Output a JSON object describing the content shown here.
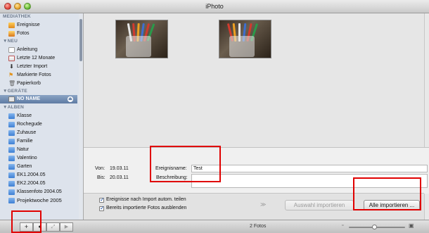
{
  "window": {
    "title": "iPhoto"
  },
  "sidebar": {
    "sections": [
      {
        "label": "MEDIATHEK"
      },
      {
        "label": "▼NEU"
      },
      {
        "label": "▼GERÄTE"
      },
      {
        "label": "▼ALBEN"
      }
    ],
    "mediathek": [
      {
        "label": "Ereignisse",
        "icon": "events-icon"
      },
      {
        "label": "Fotos",
        "icon": "photos-icon"
      }
    ],
    "neu": [
      {
        "label": "Anleitung",
        "icon": "document-icon"
      },
      {
        "label": "Letzte 12 Monate",
        "icon": "calendar-icon"
      },
      {
        "label": "Letzter Import",
        "icon": "import-icon"
      },
      {
        "label": "Markierte Fotos",
        "icon": "flag-icon"
      },
      {
        "label": "Papierkorb",
        "icon": "trash-icon"
      }
    ],
    "geraete": [
      {
        "label": "NO NAME",
        "icon": "device-icon",
        "selected": true
      }
    ],
    "alben": [
      {
        "label": "Klasse"
      },
      {
        "label": "Rochegude"
      },
      {
        "label": "Zuhause"
      },
      {
        "label": "Familie"
      },
      {
        "label": "Natur"
      },
      {
        "label": "Valentino"
      },
      {
        "label": "Garten"
      },
      {
        "label": "EK1.2004.05"
      },
      {
        "label": "EK2.2004.05"
      },
      {
        "label": "Klassenfoto 2004.05"
      },
      {
        "label": "Projektwoche 2005"
      }
    ]
  },
  "info": {
    "von_label": "Von:",
    "von_value": "19.03.11",
    "bis_label": "Bis:",
    "bis_value": "20.03.11",
    "ereignisname_label": "Ereignisname:",
    "ereignisname_value": "Test",
    "beschreibung_label": "Beschreibung:",
    "beschreibung_value": ""
  },
  "options": {
    "split_events_label": "Ereignisse nach Import autom. teilen",
    "split_events_checked": true,
    "hide_imported_label": "Bereits importierte Fotos ausblenden",
    "hide_imported_checked": true,
    "import_selected_label": "Auswahl importieren",
    "import_all_label": "Alle importieren ..."
  },
  "toolbar": {
    "add_label": "+",
    "info_label": "●",
    "photo_count": "2 Fotos"
  },
  "zoom": {
    "level": 0.45
  },
  "colors": {
    "highlight": "#e00000",
    "selection": "#5e7ba3"
  }
}
